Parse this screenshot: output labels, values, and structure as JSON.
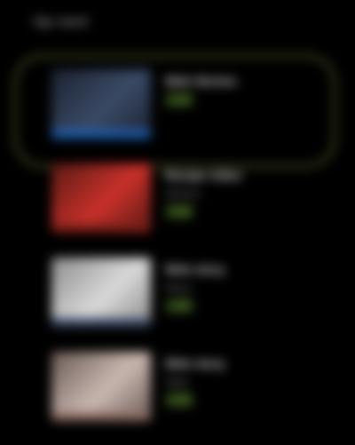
{
  "header": {
    "title": "Up next"
  },
  "accent_color": "#7fbf3a",
  "items": [
    {
      "title": "Web Stories",
      "channel": "",
      "duration": "2:10",
      "selected": true,
      "thumb_colors": [
        "#1c2230",
        "#3a4a66",
        "#1d5fb0"
      ]
    },
    {
      "title": "Recipe video",
      "channel": "Kitchen",
      "duration": "3:45",
      "selected": false,
      "thumb_colors": [
        "#5a1a14",
        "#c8302a",
        "#7a1e18"
      ]
    },
    {
      "title": "Web story",
      "channel": "News",
      "duration": "1:30",
      "selected": false,
      "thumb_colors": [
        "#8c8c8c",
        "#d8d8d8",
        "#3a4a66"
      ]
    },
    {
      "title": "Web story",
      "channel": "Style",
      "duration": "2:05",
      "selected": false,
      "thumb_colors": [
        "#6a5a55",
        "#c9b8b0",
        "#8a6a60"
      ]
    }
  ]
}
